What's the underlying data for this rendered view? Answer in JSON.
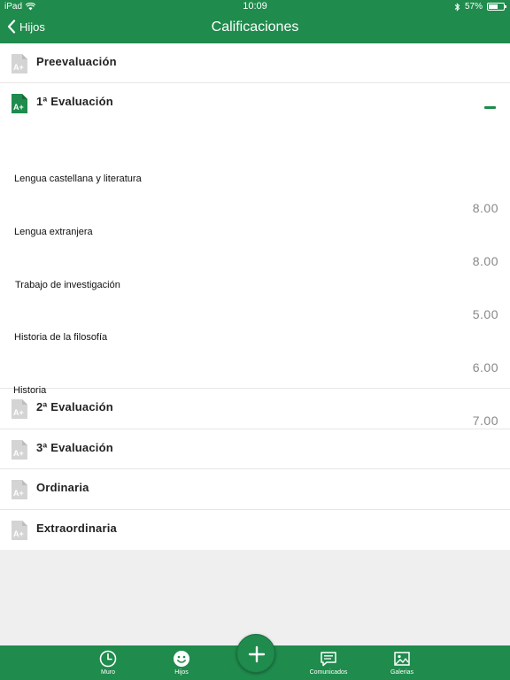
{
  "status_bar": {
    "device": "iPad",
    "time": "10:09",
    "battery": "57%"
  },
  "nav": {
    "back_label": "Hijos",
    "title": "Calificaciones"
  },
  "sections": [
    {
      "label": "Preevaluación",
      "active": false
    },
    {
      "label": "1ª Evaluación",
      "active": true
    },
    {
      "label": "2ª Evaluación",
      "active": false
    },
    {
      "label": "3ª Evaluación",
      "active": false
    },
    {
      "label": "Ordinaria",
      "active": false
    },
    {
      "label": "Extraordinaria",
      "active": false
    }
  ],
  "grades": [
    {
      "subject": "Lengua castellana  y literatura",
      "grade": "8.00"
    },
    {
      "subject": "Lengua extranjera",
      "grade": "8.00"
    },
    {
      "subject": "Trabajo de investigación",
      "grade": "5.00"
    },
    {
      "subject": "Historia de la filosofía",
      "grade": "6.00"
    },
    {
      "subject": "Historia",
      "grade": "7.00"
    }
  ],
  "tabs": [
    {
      "label": "Muro",
      "icon": "clock-icon"
    },
    {
      "label": "Hijos",
      "icon": "smiley-icon"
    },
    {
      "label": "Comunicados",
      "icon": "chat-icon"
    },
    {
      "label": "Galerias",
      "icon": "image-icon"
    }
  ],
  "colors": {
    "primary": "#1f8b4c",
    "inactive_icon": "#d4d4d4",
    "grade_text": "#888888"
  }
}
